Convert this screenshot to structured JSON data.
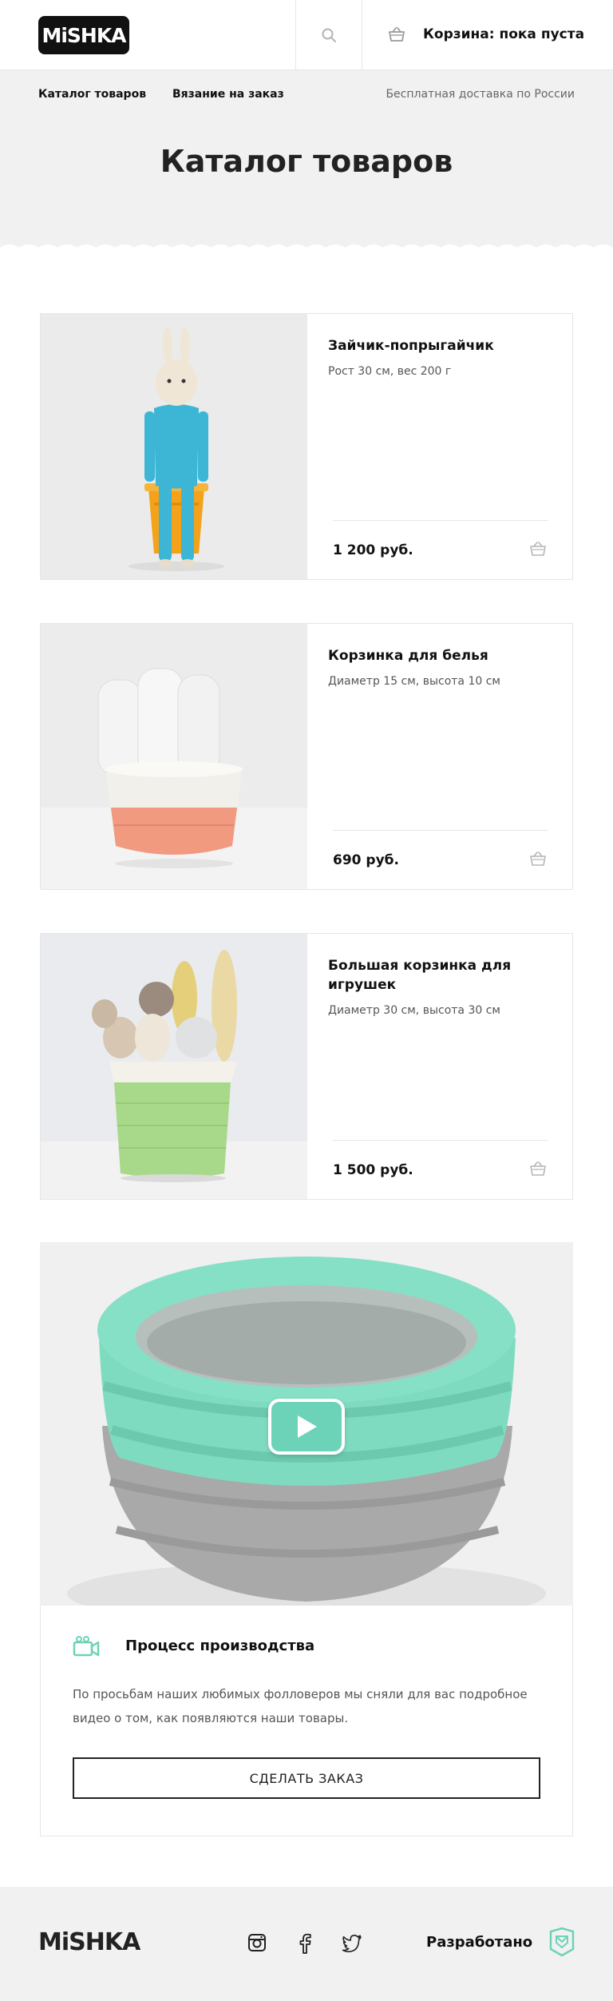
{
  "header": {
    "logo_text": "MiSHKA",
    "search_icon": "search-icon",
    "cart_icon": "basket-icon",
    "cart_label": "Корзина: пока пуста"
  },
  "nav": {
    "links": [
      {
        "label": "Каталог товаров"
      },
      {
        "label": "Вязание на заказ"
      }
    ],
    "delivery_note": "Бесплатная доставка по России"
  },
  "page": {
    "title": "Каталог товаров"
  },
  "products": [
    {
      "name": "Зайчик-попрыгайчик",
      "description": "Рост 30 см, вес 200 г",
      "price": "1 200 руб.",
      "image": "crochet-bunny-photo"
    },
    {
      "name": "Корзинка для белья",
      "description": "Диаметр 15 см, высота 10 см",
      "price": "690 руб.",
      "image": "laundry-basket-photo"
    },
    {
      "name": "Большая корзинка для игрушек",
      "description": "Диаметр 30 см, высота 30 см",
      "price": "1 500 руб.",
      "image": "toy-basket-photo"
    }
  ],
  "video_block": {
    "play_icon": "play-icon",
    "camera_icon": "video-camera-icon",
    "title": "Процесс производства",
    "text": "По просьбам наших любимых фолловеров мы сняли для вас подробное видео о том, как появляются наши товары.",
    "button_label": "СДЕЛАТЬ ЗАКАЗ"
  },
  "footer": {
    "logo_text": "MiSHKA",
    "social": [
      "instagram-icon",
      "facebook-icon",
      "twitter-icon"
    ],
    "developed_label": "Разработано",
    "developer_logo": "developer-logo"
  },
  "colors": {
    "accent": "#6dd3b8",
    "hero_bg": "#f1f1f1",
    "text": "#111111"
  }
}
